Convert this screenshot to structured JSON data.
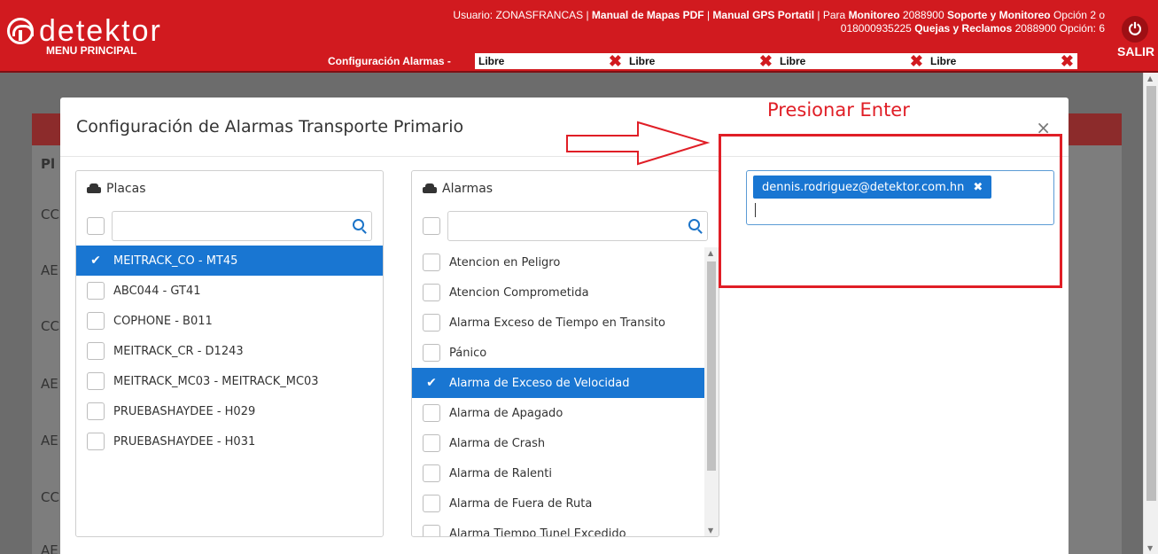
{
  "header": {
    "logo_text": "detektor",
    "menu_label": "MENU PRINCIPAL",
    "info_line1_prefix": "Usuario: ZONASFRANCAS | ",
    "manual_mapas": "Manual de Mapas PDF",
    "sep1": " | ",
    "manual_gps": "Manual GPS Portatil",
    "para": " | Para ",
    "monitoreo": "Monitoreo",
    "monitoreo_num": " 2088900 ",
    "soporte": "Soporte y Monitoreo",
    "opcion2": " Opción 2 o",
    "line2_num": "018000935225 ",
    "quejas": "Quejas y Reclamos",
    "line2_tail": " 2088900 Opción: 6",
    "salir": "SALIR",
    "power_icon": "⏻"
  },
  "tabs": {
    "config_label": "Configuración Alarmas -",
    "slots": [
      "Libre",
      "Libre",
      "Libre",
      "Libre"
    ],
    "close_glyph": "✖"
  },
  "background": {
    "column_header": "Pl",
    "rows": [
      "CC",
      "AE",
      "CC",
      "AE",
      "AE",
      "CC",
      "AE"
    ]
  },
  "modal": {
    "title": "Configuración de Alarmas Transporte Primario",
    "close_glyph": "×",
    "placas": {
      "header": "Placas",
      "search_placeholder": "",
      "items": [
        {
          "label": "MEITRACK_CO - MT45",
          "selected": true
        },
        {
          "label": "ABC044 - GT41",
          "selected": false
        },
        {
          "label": "COPHONE - B011",
          "selected": false
        },
        {
          "label": "MEITRACK_CR - D1243",
          "selected": false
        },
        {
          "label": "MEITRACK_MC03 - MEITRACK_MC03",
          "selected": false
        },
        {
          "label": "PRUEBASHAYDEE - H029",
          "selected": false
        },
        {
          "label": "PRUEBASHAYDEE - H031",
          "selected": false
        }
      ]
    },
    "alarmas": {
      "header": "Alarmas",
      "search_placeholder": "",
      "items": [
        {
          "label": "Atencion en Peligro",
          "selected": false
        },
        {
          "label": "Atencion Comprometida",
          "selected": false
        },
        {
          "label": "Alarma Exceso de Tiempo en Transito",
          "selected": false
        },
        {
          "label": "Pánico",
          "selected": false
        },
        {
          "label": "Alarma de Exceso de Velocidad",
          "selected": true
        },
        {
          "label": "Alarma de Apagado",
          "selected": false
        },
        {
          "label": "Alarma de Crash",
          "selected": false
        },
        {
          "label": "Alarma de Ralenti",
          "selected": false
        },
        {
          "label": "Alarma de Fuera de Ruta",
          "selected": false
        },
        {
          "label": "Alarma Tiempo Tunel Excedido",
          "selected": false
        }
      ]
    },
    "email": {
      "chip": "dennis.rodriguez@detektor.com.hn",
      "chip_remove": "✖"
    }
  },
  "annotation": {
    "text": "Presionar Enter"
  },
  "colors": {
    "brand_red": "#d11a1f",
    "selection_blue": "#1976d2",
    "annotation_red": "#e01e26"
  }
}
